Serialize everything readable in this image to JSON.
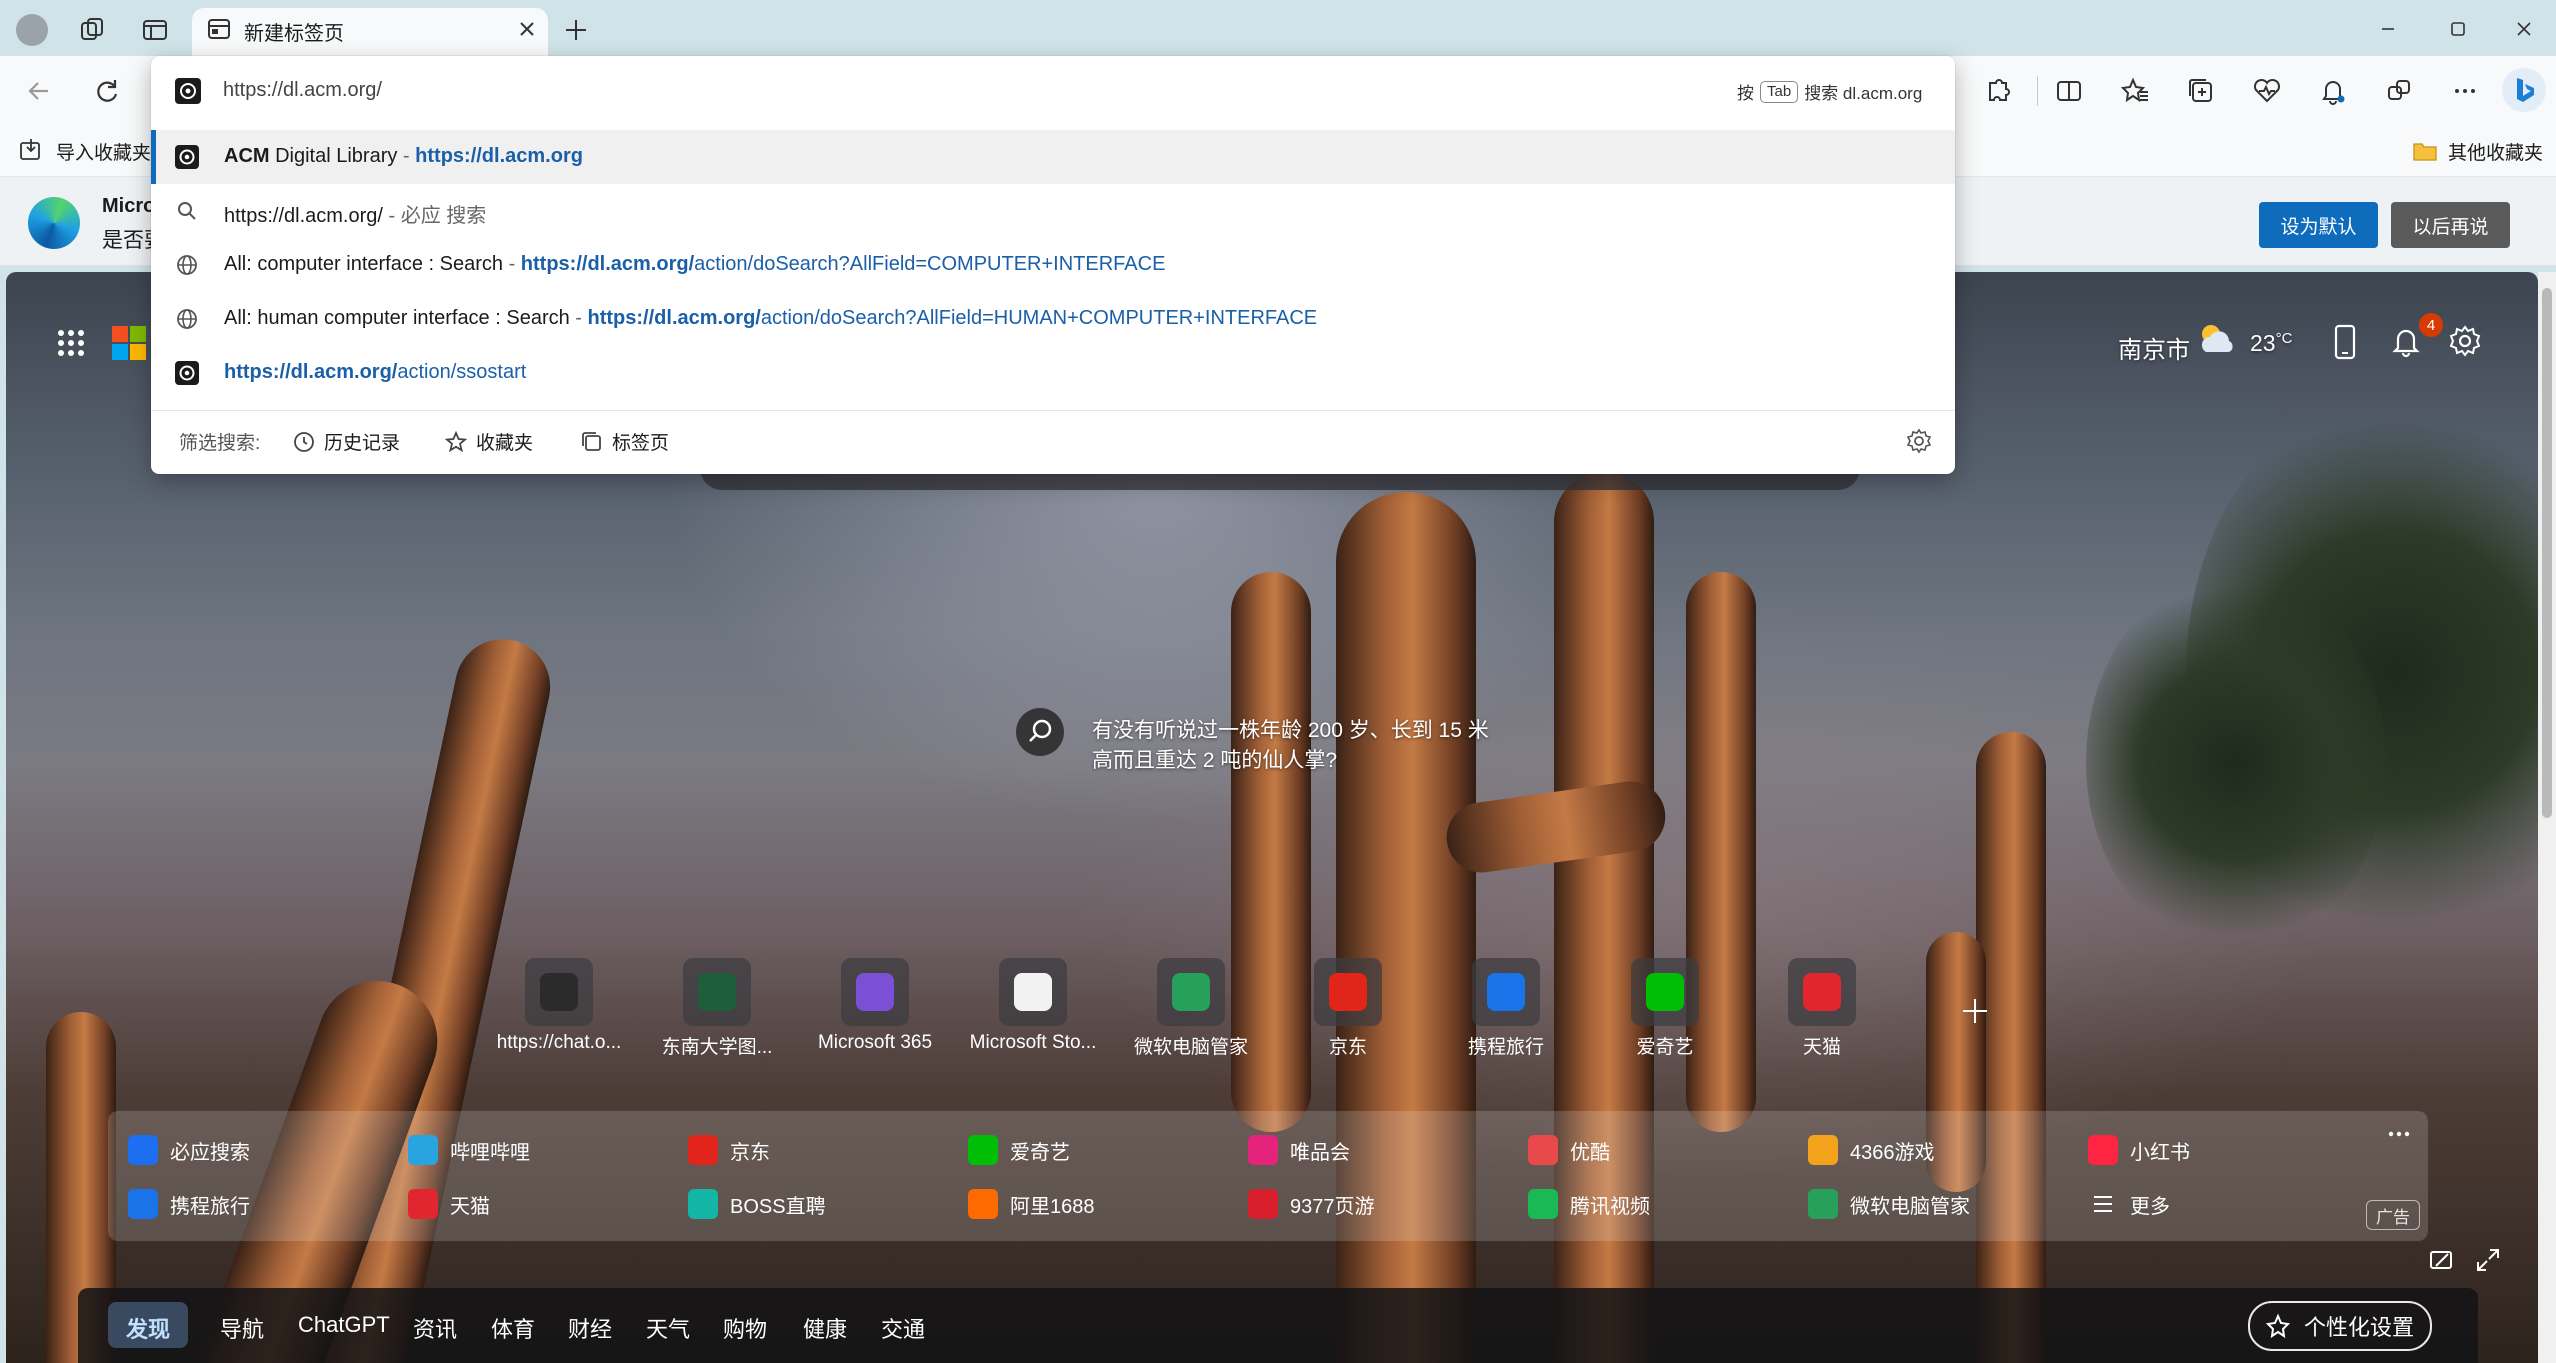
{
  "tab": {
    "title": "新建标签页"
  },
  "omnibox": {
    "input_value": "https://dl.acm.org/",
    "tab_hint_prefix": "按",
    "tab_key": "Tab",
    "tab_hint_suffix": "搜索 dl.acm.org",
    "suggestions": [
      {
        "title_bold": "ACM",
        "title_rest": " Digital Library",
        "sep": " - ",
        "url": "https://dl.acm.org"
      },
      {
        "text": "https://dl.acm.org/",
        "suffix": " - 必应 搜索"
      },
      {
        "title": "All: computer interface : Search",
        "sep": " - ",
        "url_host": "https://dl.acm.org/",
        "url_path": "action/doSearch?AllField=COMPUTER+INTERFACE"
      },
      {
        "title": "All: human computer interface : Search",
        "sep": " - ",
        "url_host": "https://dl.acm.org/",
        "url_path": "action/doSearch?AllField=HUMAN+COMPUTER+INTERFACE"
      },
      {
        "url_host": "https://dl.acm.org/",
        "url_path": "action/ssostart"
      }
    ],
    "filter_label": "筛选搜索:",
    "filters": [
      "历史记录",
      "收藏夹",
      "标签页"
    ]
  },
  "favorites_bar": {
    "import": "导入收藏夹",
    "other": "其他收藏夹"
  },
  "banner": {
    "title": "Micro",
    "subtitle": "是否要",
    "set_default": "设为默认",
    "later": "以后再说"
  },
  "weather": {
    "city": "南京市",
    "temp": "23",
    "unit": "°C"
  },
  "notifications": {
    "count": "4"
  },
  "caption": {
    "text": "有没有听说过一株年龄 200 岁、长到 15 米高而且重达 2 吨的仙人掌?"
  },
  "quick_links": [
    {
      "label": "https://chat.o...",
      "icon": "chatgpt-icon",
      "color": "#2b2b2b"
    },
    {
      "label": "东南大学图...",
      "icon": "seu-icon",
      "color": "#1f5e3a"
    },
    {
      "label": "Microsoft 365",
      "icon": "m365-icon",
      "color": "#7b4fd6"
    },
    {
      "label": "Microsoft Sto...",
      "icon": "store-icon",
      "color": "#f2f2f2"
    },
    {
      "label": "微软电脑管家",
      "icon": "pcmanager-icon",
      "color": "#27a05b"
    },
    {
      "label": "京东",
      "icon": "jd-icon",
      "color": "#e1251b"
    },
    {
      "label": "携程旅行",
      "icon": "ctrip-icon",
      "color": "#1a73e8"
    },
    {
      "label": "爱奇艺",
      "icon": "iqiyi-icon",
      "color": "#00be06"
    },
    {
      "label": "天猫",
      "icon": "tmall-icon",
      "color": "#e0262e"
    }
  ],
  "links_row1": [
    {
      "label": "必应搜索",
      "icon": "bing-search-icon",
      "color": "#1d6ff2"
    },
    {
      "label": "哔哩哔哩",
      "icon": "bilibili-icon",
      "color": "#2aa4e0"
    },
    {
      "label": "京东",
      "icon": "jd-icon",
      "color": "#e1251b"
    },
    {
      "label": "爱奇艺",
      "icon": "iqiyi-icon",
      "color": "#00be06"
    },
    {
      "label": "唯品会",
      "icon": "vip-icon",
      "color": "#e4237d"
    },
    {
      "label": "优酷",
      "icon": "youku-icon",
      "color": "#e8494b"
    },
    {
      "label": "4366游戏",
      "icon": "game4366-icon",
      "color": "#f2a21b"
    },
    {
      "label": "小红书",
      "icon": "xhs-icon",
      "color": "#ff2442"
    }
  ],
  "links_row2": [
    {
      "label": "携程旅行",
      "icon": "ctrip-icon",
      "color": "#1a73e8"
    },
    {
      "label": "天猫",
      "icon": "tmall-icon",
      "color": "#e0262e"
    },
    {
      "label": "BOSS直聘",
      "icon": "boss-icon",
      "color": "#13b5a5"
    },
    {
      "label": "阿里1688",
      "icon": "ali1688-icon",
      "color": "#ff6a00"
    },
    {
      "label": "9377页游",
      "icon": "game9377-icon",
      "color": "#d81e2b"
    },
    {
      "label": "腾讯视频",
      "icon": "tencent-video-icon",
      "color": "#19b955"
    },
    {
      "label": "微软电脑管家",
      "icon": "pcmanager-icon",
      "color": "#27a05b"
    },
    {
      "label": "更多",
      "icon": "more-list-icon",
      "color": "transparent"
    }
  ],
  "ad_label": "广告",
  "feed_nav": {
    "items": [
      "发现",
      "导航",
      "ChatGPT",
      "资讯",
      "体育",
      "财经",
      "天气",
      "购物",
      "健康",
      "交通"
    ],
    "personalize": "个性化设置"
  }
}
